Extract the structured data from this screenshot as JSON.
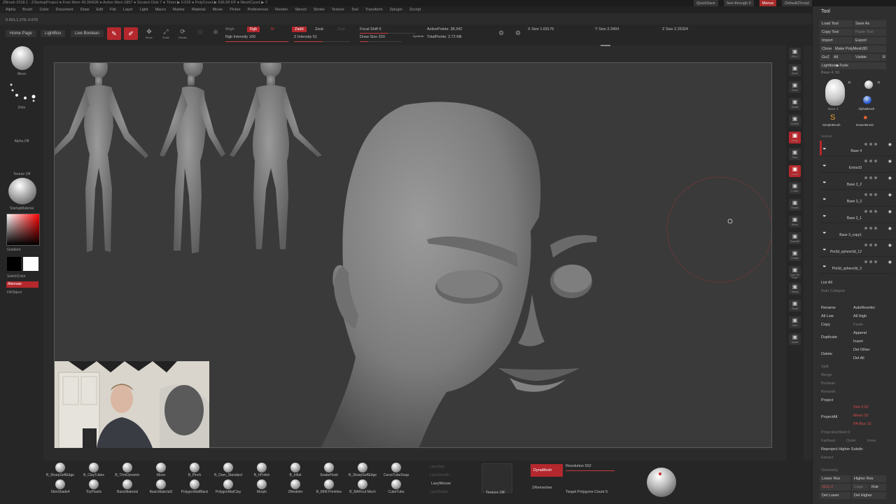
{
  "titlebar": {
    "text": "ZBrush 2018.1 - ZStartupProject ● Free Mem 49.364GB ● Active Mem 1857 ● Scratch Disk 7 ● Timer ▶ 0.029 ● PolyCount ▶ 536.58 KP ● MeshCount ▶ 7"
  },
  "menu": [
    "Alpha",
    "Brush",
    "Color",
    "Document",
    "Draw",
    "Edit",
    "File",
    "Layer",
    "Light",
    "Macro",
    "Marker",
    "Material",
    "Movie",
    "Picker",
    "Preferences",
    "Render",
    "Stencil",
    "Stroke",
    "Texture",
    "Tool",
    "Transform",
    "Zplugin",
    "Zscript"
  ],
  "topright": {
    "quicksave": "QuickSave",
    "seethrough": "See-through 0",
    "menus": "Menus",
    "script": "DefaultZScript"
  },
  "coords": "0.691,1.278,-0.676",
  "toolbar": {
    "home": "Home Page",
    "lightbox": "LightBox",
    "live_boolean": "Live Boolean",
    "edit": "Edit",
    "draw": "Draw",
    "move": "Move",
    "scale": "Scale",
    "rotate": "Rotate",
    "mrgb": "Mrgb",
    "rgb": "Rgb",
    "m": "M",
    "zadd": "Zadd",
    "zsub": "Zsub",
    "zcut": "Zcut",
    "rgb_intensity": "Rgb Intensity 100",
    "z_intensity": "Z Intensity 51",
    "focal_shift": "Focal Shift 0",
    "draw_size": "Draw Size 203",
    "dynamic": "Dynamic",
    "active_points": "ActivePoints: 38,342",
    "total_points": "TotalPoints: 2.72 Mil",
    "x_size": "X Size 1.69176",
    "y_size": "Y Size 2.3404",
    "z_size": "Z Size 2.25324"
  },
  "leftshelf": {
    "move": "Move",
    "dots": "Dots",
    "alpha_off": "Alpha Off",
    "texture_off": "Texture Off",
    "material": "StartupMaterial",
    "gradient": "Gradient",
    "switchcolor": "SwitchColor",
    "alternate": "Alternate",
    "fillobject": "FillObject"
  },
  "rightshelf": [
    "SPix 3",
    "Scroll",
    "Zoom",
    "Actual",
    "AAHalf",
    "Persp",
    "Floor",
    "Local",
    "L.Sym",
    "Frame",
    "Move",
    "Zoom3D",
    "Rotate",
    "Line Fill PolyF",
    "Transp",
    "Ghost",
    "Solo",
    "Xpose"
  ],
  "bottom": {
    "brushes_row1": [
      "B_SharpSoftEdge",
      "B_ClayTubes",
      "B_TrimDynamic",
      "Move",
      "B_Pinch",
      "B_Dam_Standard",
      "B_hPolish",
      "B_Inflat",
      "SnakeHook",
      "B_SharpSoftEdge",
      "CurveTubeSnap"
    ],
    "brushes_row2": [
      "SkinShade4",
      "ToyPlastic",
      "BasicMaterial",
      "BasicMaterial2",
      "PolygonMatBlack",
      "PolygonMatClay",
      "Morph",
      "ZModeler",
      "B_IMM Primitive",
      "B_MAHcut Mech",
      "CubeTube"
    ],
    "lazy_mouse": "LazyMouse",
    "lazy_step": "LazyStep",
    "lazy_radius": "LazyRadius",
    "lazy_smooth": "LazySmooth",
    "texture_off": "Texture Off",
    "dynamesh": "DynaMesh",
    "resolution": "Resolution 552",
    "zremesher": "ZRemesher",
    "target_polys": "Target Polygons Count 5"
  },
  "tray": {
    "title": "Tool",
    "buttons": [
      "Load Tool",
      "Save As",
      "Copy Tool",
      "Paste Tool",
      "Import",
      "Export",
      "Clone",
      "Make PolyMesh3D",
      "GoZ",
      "All",
      "Visible",
      "R",
      "Lightbox▶Tools"
    ],
    "base_label": "Base 4. 50",
    "tools": [
      "Base 4",
      "AlphaBrush",
      "SimpleBrush",
      "EraserBrush"
    ],
    "tool_counts": [
      "11",
      "11"
    ],
    "subtool_header": "Subtool",
    "subtools": [
      "Base 4",
      "Extract3",
      "Base 3_2",
      "Base 3_3",
      "Base 3_1",
      "Base 3_copy1",
      "Pm3d_sphere3d_12",
      "Pm3d_sphere3d_3"
    ],
    "list_all": "List All",
    "auto_collapse": "Auto Collapse",
    "rename": "Rename",
    "autoreorder": "AutoReorder",
    "all_low": "All Low",
    "all_high": "All High",
    "copy": "Copy",
    "paste": "Paste",
    "append": "Append",
    "duplicate": "Duplicate",
    "insert": "Insert",
    "delete": "Delete",
    "del_other": "Del Other",
    "del_all": "Del All",
    "split": "Split",
    "merge": "Merge",
    "boolean": "Boolean",
    "remesh": "Remesh",
    "project": "Project",
    "projectall": "ProjectAll",
    "dist": "Dist 0.02",
    "mean": "Mean 25",
    "pa_blur": "PA Blur 10",
    "projection_shell": "ProjectionShell 0",
    "farthest": "Farthest",
    "outer": "Outer",
    "inner": "Inner",
    "reproject": "Reproject Higher Subdiv",
    "extract": "Extract",
    "geometry": "Geometry",
    "lower_res": "Lower Res",
    "higher_res": "Higher Res",
    "sdiv": "SDiv 2",
    "cage": "Cage",
    "rstr": "Rstr",
    "del_lower": "Del Lower",
    "del_higher": "Del Higher",
    "start": "START",
    "end": "START"
  },
  "colors": {
    "accent": "#b4282d",
    "panel": "#2f2f2f",
    "canvas": "#3a3a3a"
  }
}
